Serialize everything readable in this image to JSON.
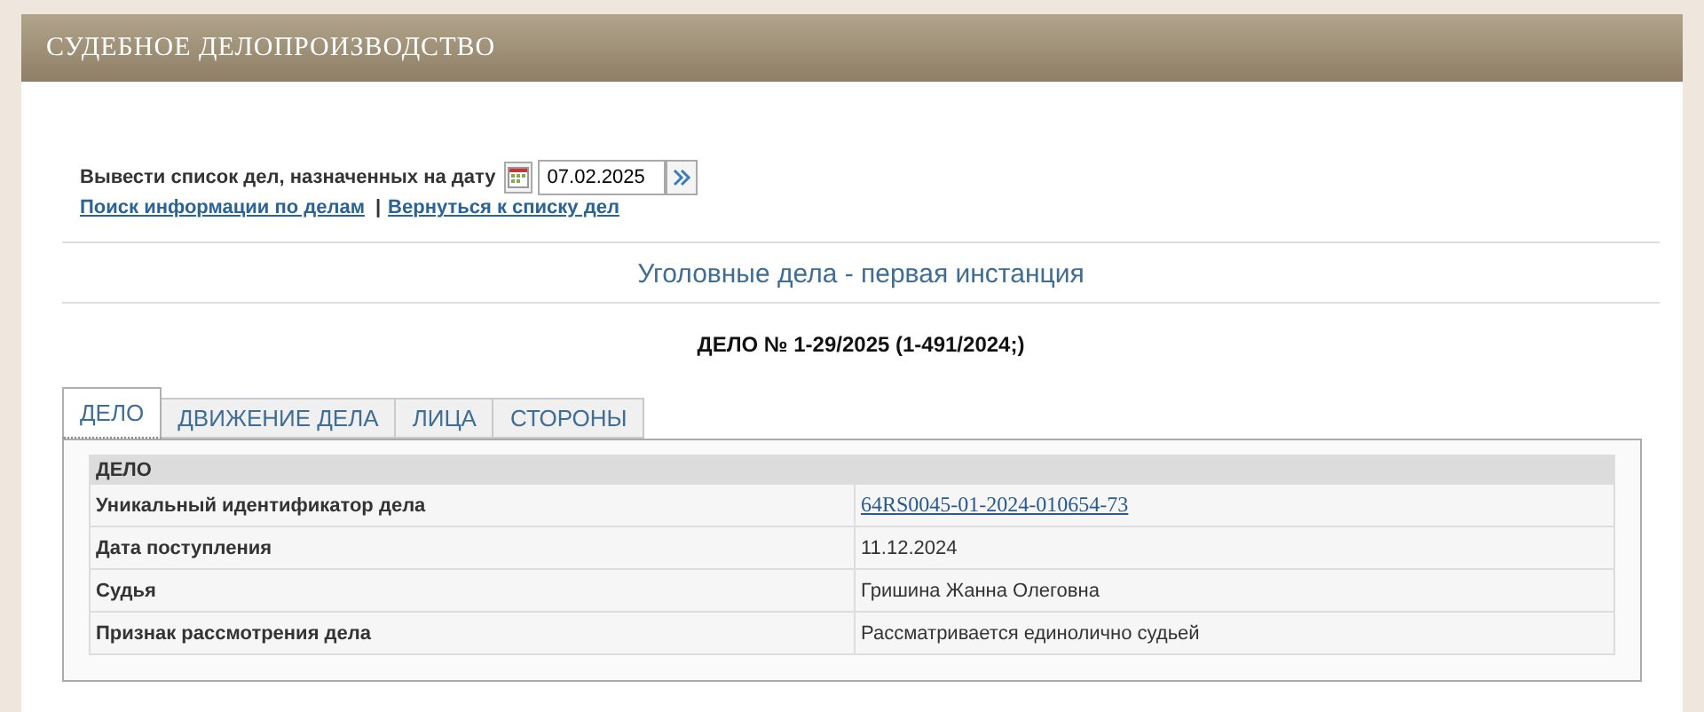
{
  "header": {
    "title": "СУДЕБНОЕ ДЕЛОПРОИЗВОДСТВО"
  },
  "date_filter": {
    "label": "Вывести список дел, назначенных на дату",
    "value": "07.02.2025"
  },
  "link_separator": "|",
  "links": [
    {
      "text": "Поиск информации по делам"
    },
    {
      "text": "Вернуться к списку дел"
    }
  ],
  "section_title": "Уголовные дела - первая инстанция",
  "case_number": "ДЕЛО № 1-29/2025 (1-491/2024;)",
  "tabs": [
    {
      "label": "ДЕЛО",
      "selected": true
    },
    {
      "label": "ДВИЖЕНИЕ ДЕЛА",
      "selected": false
    },
    {
      "label": "ЛИЦА",
      "selected": false
    },
    {
      "label": "СТОРОНЫ",
      "selected": false
    }
  ],
  "table": {
    "heading": "ДЕЛО",
    "rows": [
      {
        "label": "Уникальный идентификатор дела",
        "value": "64RS0045-01-2024-010654-73",
        "kind": "link"
      },
      {
        "label": "Дата поступления",
        "value": "11.12.2024",
        "kind": "text"
      },
      {
        "label": "Судья",
        "value": "Гришина Жанна Олеговна",
        "kind": "text"
      },
      {
        "label": "Признак рассмотрения дела",
        "value": "Рассматривается единолично судьей",
        "kind": "text"
      }
    ]
  }
}
